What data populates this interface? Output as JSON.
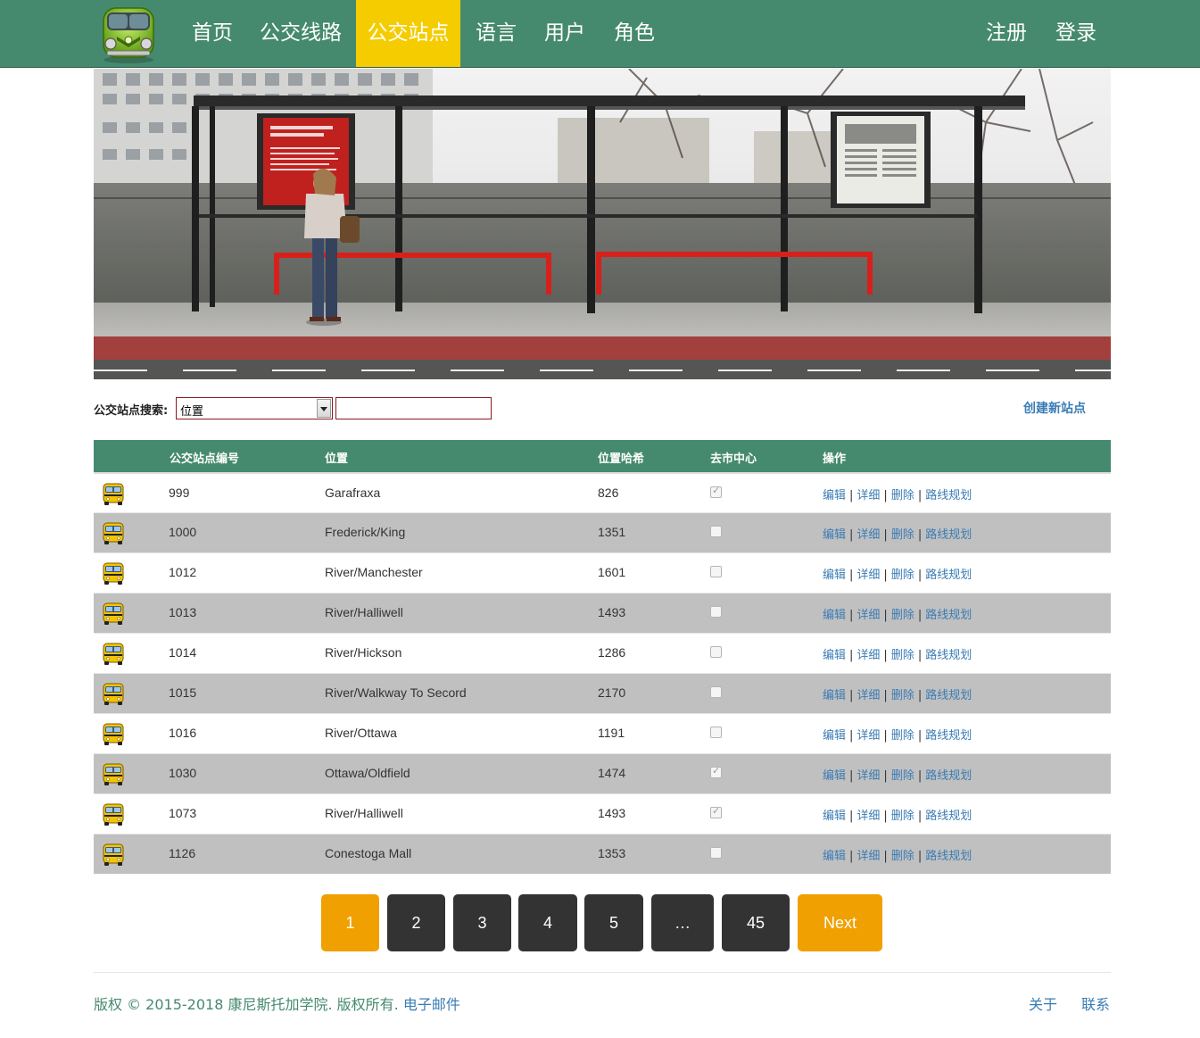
{
  "nav": {
    "items": [
      {
        "label": "首页",
        "active": false
      },
      {
        "label": "公交线路",
        "active": false
      },
      {
        "label": "公交站点",
        "active": true
      },
      {
        "label": "语言",
        "active": false
      },
      {
        "label": "用户",
        "active": false
      },
      {
        "label": "角色",
        "active": false
      }
    ],
    "register": "注册",
    "login": "登录",
    "colors": {
      "bar": "#458a6e",
      "active": "#f5cc00"
    }
  },
  "search": {
    "label": "公交站点搜索:",
    "select_value": "位置",
    "input_value": "",
    "create_label": "创建新站点"
  },
  "table": {
    "headers": [
      "公交站点编号",
      "位置",
      "位置哈希",
      "去市中心",
      "操作"
    ],
    "ops": {
      "edit": "编辑",
      "detail": "详细",
      "delete": "删除",
      "route": "路线规划",
      "separator": "|"
    },
    "rows": [
      {
        "id": "999",
        "location": "Garafraxa",
        "hash": "826",
        "downtown": true
      },
      {
        "id": "1000",
        "location": "Frederick/King",
        "hash": "1351",
        "downtown": false
      },
      {
        "id": "1012",
        "location": "River/Manchester",
        "hash": "1601",
        "downtown": false
      },
      {
        "id": "1013",
        "location": "River/Halliwell",
        "hash": "1493",
        "downtown": false
      },
      {
        "id": "1014",
        "location": "River/Hickson",
        "hash": "1286",
        "downtown": false
      },
      {
        "id": "1015",
        "location": "River/Walkway To Secord",
        "hash": "2170",
        "downtown": false
      },
      {
        "id": "1016",
        "location": "River/Ottawa",
        "hash": "1191",
        "downtown": false
      },
      {
        "id": "1030",
        "location": "Ottawa/Oldfield",
        "hash": "1474",
        "downtown": true
      },
      {
        "id": "1073",
        "location": "River/Halliwell",
        "hash": "1493",
        "downtown": true
      },
      {
        "id": "1126",
        "location": "Conestoga Mall",
        "hash": "1353",
        "downtown": false
      }
    ]
  },
  "pagination": {
    "pages": [
      "1",
      "2",
      "3",
      "4",
      "5",
      "…",
      "45"
    ],
    "current": "1",
    "next": "Next",
    "colors": {
      "active": "#f0a000",
      "default": "#333333"
    }
  },
  "footer": {
    "copyright": "版权 © 2015-2018 康尼斯托加学院. 版权所有.",
    "email": "电子邮件",
    "about": "关于",
    "contact": "联系"
  }
}
